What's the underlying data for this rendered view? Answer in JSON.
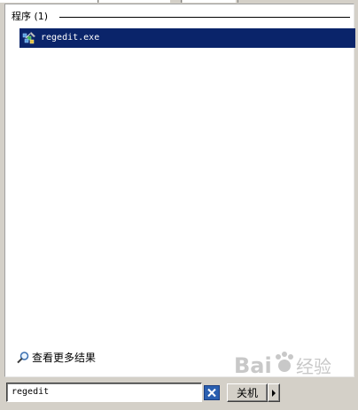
{
  "programs_section": {
    "title": "程序 (1)",
    "results": [
      {
        "label": "regedit.exe",
        "icon": "regedit-icon"
      }
    ]
  },
  "more_results": {
    "label": "查看更多结果",
    "icon": "search-icon"
  },
  "search": {
    "value": "regedit",
    "clear_icon": "clear-x-icon"
  },
  "shutdown": {
    "label": "关机",
    "arrow_icon": "triangle-right-icon"
  },
  "watermark": {
    "text": "Baidu 经验"
  },
  "colors": {
    "selection": "#0a246a",
    "window_bg": "#d4d0c8",
    "panel_bg": "#ffffff",
    "clear_button": "#2a5fb0"
  }
}
